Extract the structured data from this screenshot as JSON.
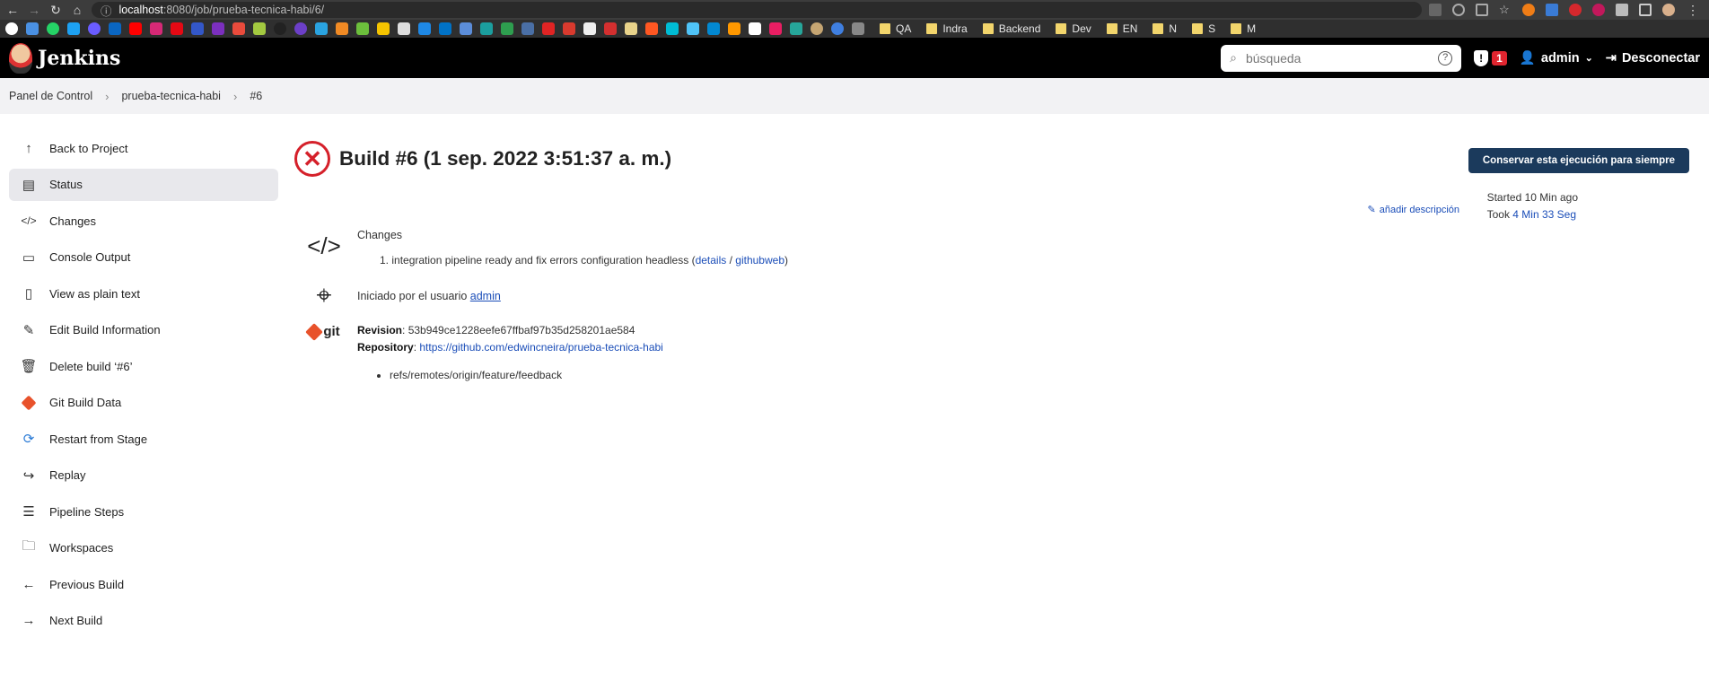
{
  "browser": {
    "url_host": "localhost",
    "url_path": ":8080/job/prueba-tecnica-habi/6/",
    "bookmark_folders": [
      "QA",
      "Indra",
      "Backend",
      "Dev",
      "EN",
      "N",
      "S",
      "M"
    ]
  },
  "header": {
    "brand": "Jenkins",
    "search_placeholder": "búsqueda",
    "alert_count": "1",
    "user": "admin",
    "logout": "Desconectar"
  },
  "breadcrumb": {
    "items": [
      "Panel de Control",
      "prueba-tecnica-habi",
      "#6"
    ]
  },
  "sidebar": {
    "items": [
      {
        "label": "Back to Project",
        "icon": "arrow-up-icon"
      },
      {
        "label": "Status",
        "icon": "document-icon"
      },
      {
        "label": "Changes",
        "icon": "code-icon"
      },
      {
        "label": "Console Output",
        "icon": "terminal-icon"
      },
      {
        "label": "View as plain text",
        "icon": "document-icon"
      },
      {
        "label": "Edit Build Information",
        "icon": "edit-icon"
      },
      {
        "label": "Delete build ‘#6’",
        "icon": "trash-icon"
      },
      {
        "label": "Git Build Data",
        "icon": "git-icon"
      },
      {
        "label": "Restart from Stage",
        "icon": "restart-icon"
      },
      {
        "label": "Replay",
        "icon": "replay-icon"
      },
      {
        "label": "Pipeline Steps",
        "icon": "list-icon"
      },
      {
        "label": "Workspaces",
        "icon": "folder-icon"
      },
      {
        "label": "Previous Build",
        "icon": "arrow-left-icon"
      },
      {
        "label": "Next Build",
        "icon": "arrow-right-icon"
      }
    ]
  },
  "main": {
    "title": "Build #6 (1 sep. 2022 3:51:37 a. m.)",
    "keep_button": "Conservar esta ejecución para siempre",
    "add_description": "añadir descripción",
    "started_ago": "Started 10 Min ago",
    "took_label": "Took",
    "took_value": "4 Min 33 Seg",
    "changes": {
      "heading": "Changes",
      "entry_number": "1.",
      "entry_text": "integration pipeline ready and fix errors configuration headless",
      "details_link": "details",
      "githubweb_link": "githubweb"
    },
    "started_by": {
      "prefix": "Iniciado por el usuario",
      "user": "admin"
    },
    "git": {
      "logo_text": "git",
      "revision_label": "Revision",
      "revision_value": "53b949ce1228eefe67ffbaf97b35d258201ae584",
      "repository_label": "Repository",
      "repository_url": "https://github.com/edwincneira/prueba-tecnica-habi",
      "branch": "refs/remotes/origin/feature/feedback"
    }
  }
}
